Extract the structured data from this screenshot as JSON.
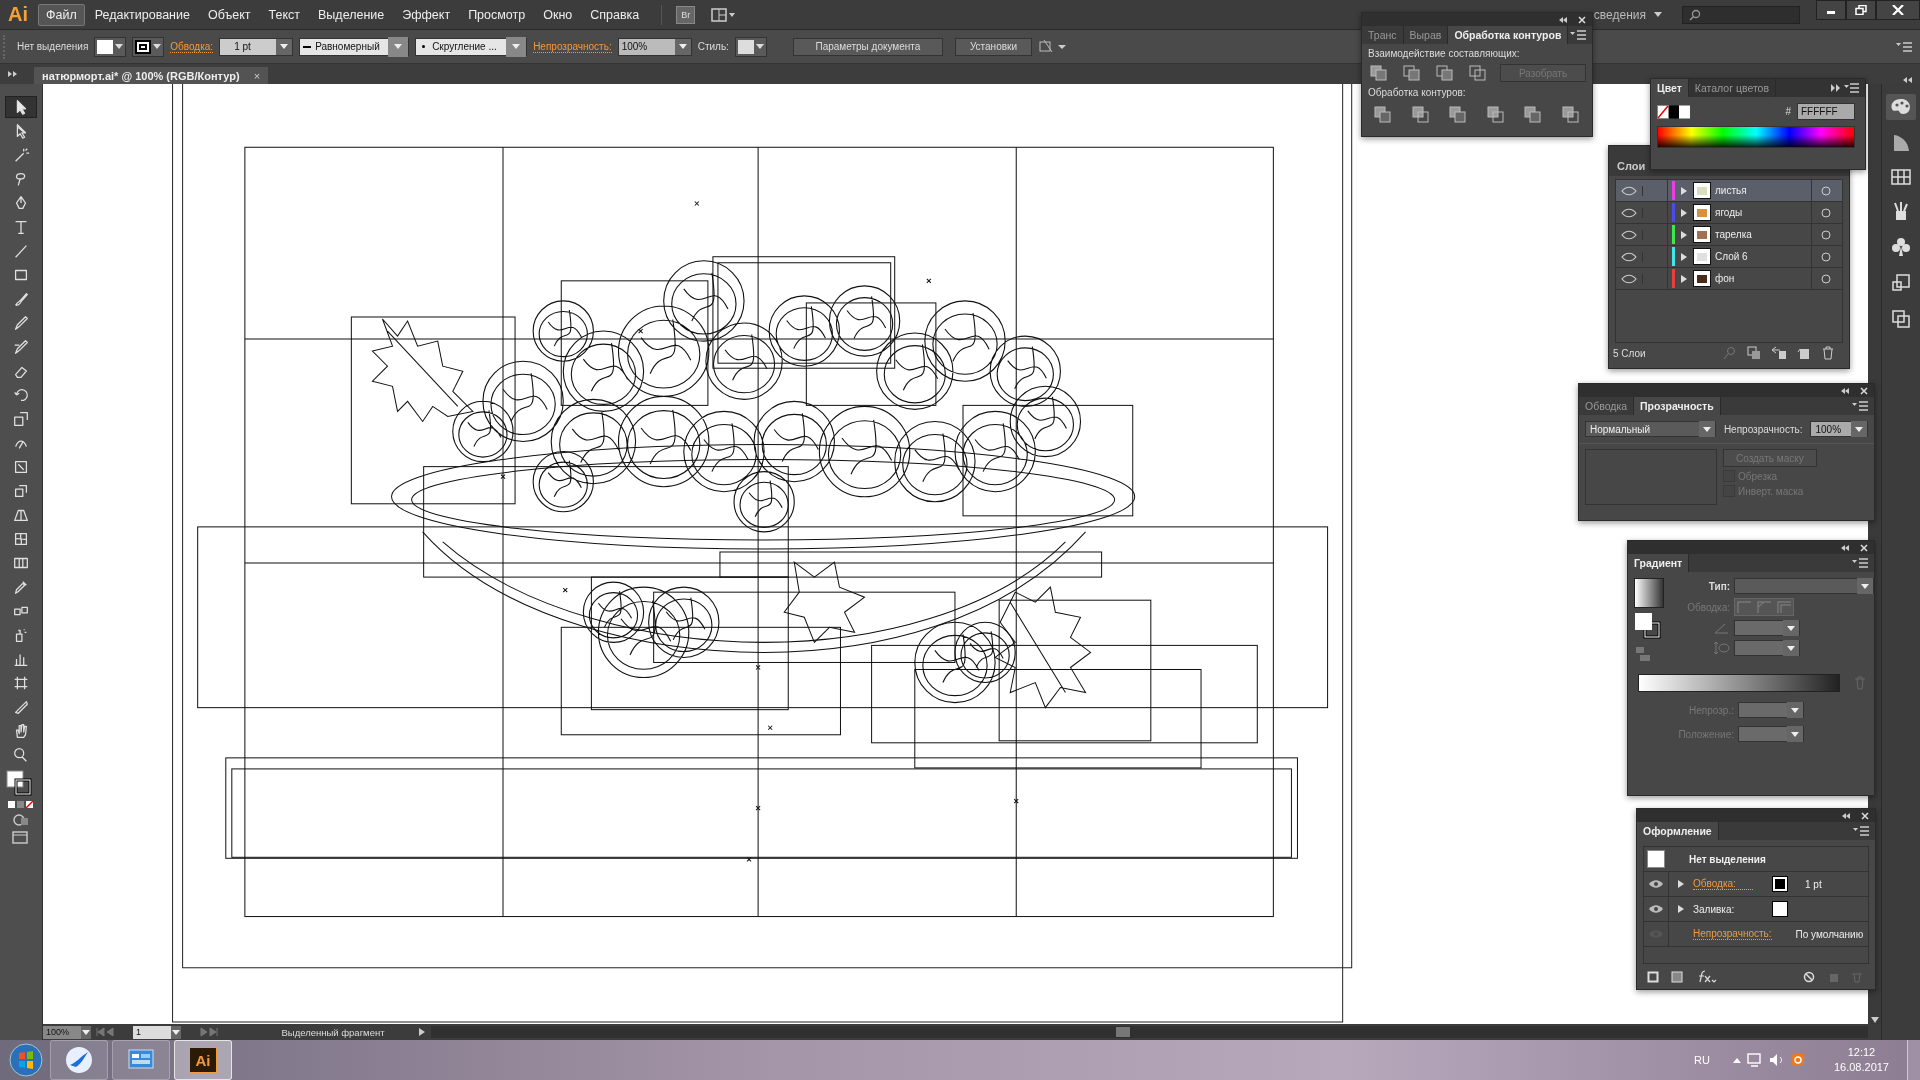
{
  "app_logo": "Ai",
  "menu": [
    {
      "label": "Файл",
      "selected": true
    },
    {
      "label": "Редактирование",
      "selected": false
    },
    {
      "label": "Объект",
      "selected": false
    },
    {
      "label": "Текст",
      "selected": false
    },
    {
      "label": "Выделение",
      "selected": false
    },
    {
      "label": "Эффект",
      "selected": false
    },
    {
      "label": "Просмотр",
      "selected": false
    },
    {
      "label": "Окно",
      "selected": false
    },
    {
      "label": "Справка",
      "selected": false
    }
  ],
  "bridge": "Br",
  "workspace": "сведения",
  "control_bar": {
    "selection": "Нет выделения",
    "stroke_label": "Обводка:",
    "stroke_weight": "1 pt",
    "profile": "Равномерный",
    "brush": "Скругление ...",
    "opacity_label": "Непрозрачность:",
    "opacity": "100%",
    "style_label": "Стиль:",
    "buttons": [
      "Параметры документа",
      "Установки"
    ]
  },
  "document_tab": {
    "title": "натюрморт.ai* @ 100% (RGB/Контур)",
    "close": "×"
  },
  "tools": [
    {
      "kind": "select",
      "selected": true
    },
    {
      "kind": "direct",
      "selected": false
    },
    {
      "kind": "wand",
      "selected": false
    },
    {
      "kind": "lasso",
      "selected": false
    },
    {
      "kind": "pen",
      "selected": false
    },
    {
      "kind": "type",
      "selected": false
    },
    {
      "kind": "line",
      "selected": false
    },
    {
      "kind": "rect",
      "selected": false
    },
    {
      "kind": "brush",
      "selected": false
    },
    {
      "kind": "pencil",
      "selected": false
    },
    {
      "kind": "blob",
      "selected": false
    },
    {
      "kind": "eraser",
      "selected": false
    },
    {
      "kind": "rotate",
      "selected": false
    },
    {
      "kind": "scale",
      "selected": false
    },
    {
      "kind": "warp",
      "selected": false
    },
    {
      "kind": "transform",
      "selected": false
    },
    {
      "kind": "builder",
      "selected": false
    },
    {
      "kind": "perspective",
      "selected": false
    },
    {
      "kind": "mesh",
      "selected": false
    },
    {
      "kind": "gradient",
      "selected": false
    },
    {
      "kind": "eyedropper",
      "selected": false
    },
    {
      "kind": "blend",
      "selected": false
    },
    {
      "kind": "spray",
      "selected": false
    },
    {
      "kind": "graph",
      "selected": false
    },
    {
      "kind": "artboard",
      "selected": false
    },
    {
      "kind": "slice",
      "selected": false
    },
    {
      "kind": "hand",
      "selected": false
    },
    {
      "kind": "zoom",
      "selected": false
    }
  ],
  "pathfinder_panel": {
    "tabs": [
      {
        "label": "Транс",
        "selected": false
      },
      {
        "label": "Вырав",
        "selected": false
      },
      {
        "label": "Обработка контуров",
        "selected": true
      }
    ],
    "shape_modes_label": "Взаимодействие составляющих:",
    "expand_button": "Разобрать",
    "pathfinders_label": "Обработка контуров:"
  },
  "color_panel": {
    "tabs": [
      {
        "label": "Цвет",
        "selected": true
      },
      {
        "label": "Каталог цветов",
        "selected": false
      }
    ],
    "hex_label": "#",
    "hex": "FFFFFF"
  },
  "layers_panel": {
    "title": "Слои",
    "layers": [
      {
        "name": "листья",
        "color": "#e83ee8",
        "visible": true,
        "selected": true
      },
      {
        "name": "ягоды",
        "color": "#4b4be8",
        "visible": true,
        "selected": false
      },
      {
        "name": "тарелка",
        "color": "#3ee84b",
        "visible": true,
        "selected": false
      },
      {
        "name": "Слой 6",
        "color": "#3ee8e8",
        "visible": true,
        "selected": false
      },
      {
        "name": "фон",
        "color": "#e83e3e",
        "visible": true,
        "selected": false
      }
    ],
    "footer": "5 Слои"
  },
  "transparency_panel": {
    "tabs": [
      {
        "label": "Обводка",
        "selected": false
      },
      {
        "label": "Прозрачность",
        "selected": true
      }
    ],
    "blend_mode": "Нормальный",
    "opacity_label": "Непрозрачность:",
    "opacity": "100%",
    "mask_button": "Создать маску",
    "options": [
      {
        "label": "Обрезка",
        "checked": false
      },
      {
        "label": "Инверт. маска",
        "checked": false
      }
    ]
  },
  "gradient_panel": {
    "title": "Градиент",
    "type_label": "Тип:",
    "stroke_label": "Обводка:",
    "opacity_label": "Непрозр.:",
    "position_label": "Положение:"
  },
  "appearance_panel": {
    "title": "Оформление",
    "header": "Нет выделения",
    "rows": [
      {
        "kind": "stroke",
        "label": "Обводка:",
        "value": "1 pt",
        "visible": true
      },
      {
        "kind": "fill",
        "label": "Заливка:",
        "visible": true
      },
      {
        "kind": "opacity",
        "label": "Непрозрачность:",
        "value": "По умолчанию",
        "visible": false
      }
    ]
  },
  "status_bar": {
    "zoom": "100%",
    "page": "1",
    "status": "Выделенный фрагмент"
  },
  "taskbar": {
    "apps": [
      {
        "kind": "bird",
        "selected": false
      },
      {
        "kind": "panel",
        "selected": false
      },
      {
        "kind": "ai",
        "label": "Ai",
        "selected": true
      }
    ],
    "language": "RU",
    "time": "12:12",
    "date": "16.08.2017"
  }
}
